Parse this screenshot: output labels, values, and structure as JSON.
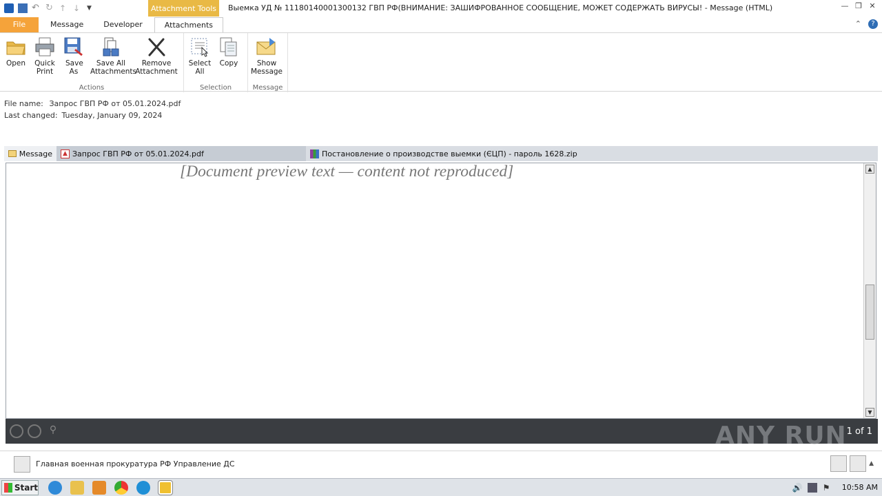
{
  "window": {
    "context_tab": "Attachment Tools",
    "title": "Выемка УД № 11180140001300132 ГВП РФ(ВНИМАНИЕ: ЗАШИФРОВАННОЕ СООБЩЕНИЕ, МОЖЕТ СОДЕРЖАТЬ ВИРУСЫ! - Message (HTML)"
  },
  "tabs": [
    "File",
    "Message",
    "Developer",
    "Attachments"
  ],
  "ribbon": {
    "actions": {
      "label": "Actions",
      "buttons": [
        "Open",
        "Quick Print",
        "Save As",
        "Save All Attachments",
        "Remove Attachment"
      ]
    },
    "selection": {
      "label": "Selection",
      "buttons": [
        "Select All",
        "Copy"
      ]
    },
    "message": {
      "label": "Message",
      "buttons": [
        "Show Message"
      ]
    }
  },
  "file_info": {
    "name_label": "File name:",
    "name_value": "Запрос ГВП РФ от 05.01.2024.pdf",
    "changed_label": "Last changed:",
    "changed_value": "Tuesday, January 09, 2024"
  },
  "attachments": [
    {
      "label": "Message"
    },
    {
      "label": "Запрос ГВП РФ от 05.01.2024.pdf"
    },
    {
      "label": "Постановление о производстве выемки (ЄЦП) - пароль 1628.zip"
    }
  ],
  "document": {
    "paragraphs": [
      "[Document preview text — content not reproduced]"
    ]
  },
  "pdf": {
    "page": "1 of 1"
  },
  "watermark": "ANY RUN",
  "people": {
    "sender": "Главная военная прокуратура РФ Управление ДС"
  },
  "taskbar": {
    "start": "Start",
    "clock": "10:58 AM"
  }
}
